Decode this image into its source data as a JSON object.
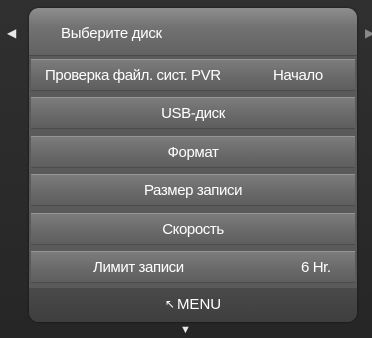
{
  "nav": {
    "left_arrow": "◀",
    "right_arrow": "▶",
    "down_arrow": "▼"
  },
  "header": {
    "title": "Выберите диск"
  },
  "menu": {
    "items": [
      {
        "label": "Проверка файл. сист. PVR",
        "value": "Начало"
      },
      {
        "label": "USB-диск",
        "value": ""
      },
      {
        "label": "Формат",
        "value": ""
      },
      {
        "label": "Размер записи",
        "value": ""
      },
      {
        "label": "Скорость",
        "value": ""
      },
      {
        "label": "Лимит записи",
        "value": "6 Hr."
      }
    ]
  },
  "footer": {
    "return_icon": "↖",
    "menu_label": "MENU"
  },
  "colors": {
    "panel": "#5a5a5a",
    "row": "#6a6a6a",
    "footer": "#424242",
    "text": "#ffffff"
  }
}
